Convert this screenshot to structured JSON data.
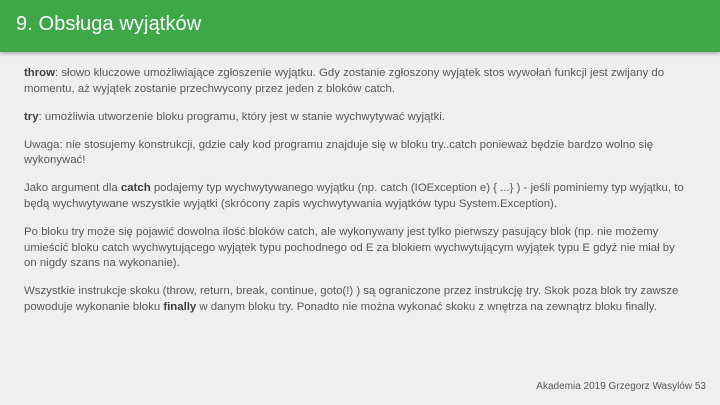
{
  "slide": {
    "title": "9. Obsługa wyjątków",
    "footer": "Akademia 2019 Grzegorz Wasylów 53"
  },
  "paragraphs": {
    "p1": {
      "kw": "throw",
      "text": ": słowo kluczowe umożliwiające zgłoszenie wyjątku. Gdy zostanie zgłoszony wyjątek stos wywołań funkcji jest zwijany do momentu, aż wyjątek zostanie przechwycony przez jeden z bloków catch."
    },
    "p2": {
      "kw": "try",
      "text": ": umożliwia utworzenie bloku programu, który jest w stanie wychwytywać wyjątki."
    },
    "p3": {
      "text": "Uwaga: nie stosujemy konstrukcji, gdzie cały kod programu znajduje się w bloku try..catch ponieważ będzie bardzo wolno się wykonywać!"
    },
    "p4": {
      "pre": "Jako argument dla ",
      "kw": "catch",
      "post": " podajemy typ wychwytywanego wyjątku (np. catch (IOException e) { ...} ) - jeśli pominiemy typ wyjątku, to będą wychwytywane wszystkie wyjątki (skrócony zapis wychwytywania wyjątków typu System.Exception)."
    },
    "p5": {
      "text": "Po bloku try może się pojawić dowolna ilość bloków catch, ale wykonywany jest tylko pierwszy pasujący blok (np. nie możemy umieścić bloku catch wychwytującego wyjątek typu pochodnego od E za blokiem wychwytującym wyjątek typu E  gdyż nie miał by on nigdy szans na wykonanie)."
    },
    "p6": {
      "pre": "Wszystkie instrukcje skoku (throw, return, break, continue, goto(!) ) są ograniczone przez instrukcję try. Skok poza blok try zawsze powoduje wykonanie bloku ",
      "kw": "finally",
      "post": " w danym bloku try. Ponadto nie można wykonać skoku z wnętrza na zewnątrz bloku finally."
    }
  }
}
